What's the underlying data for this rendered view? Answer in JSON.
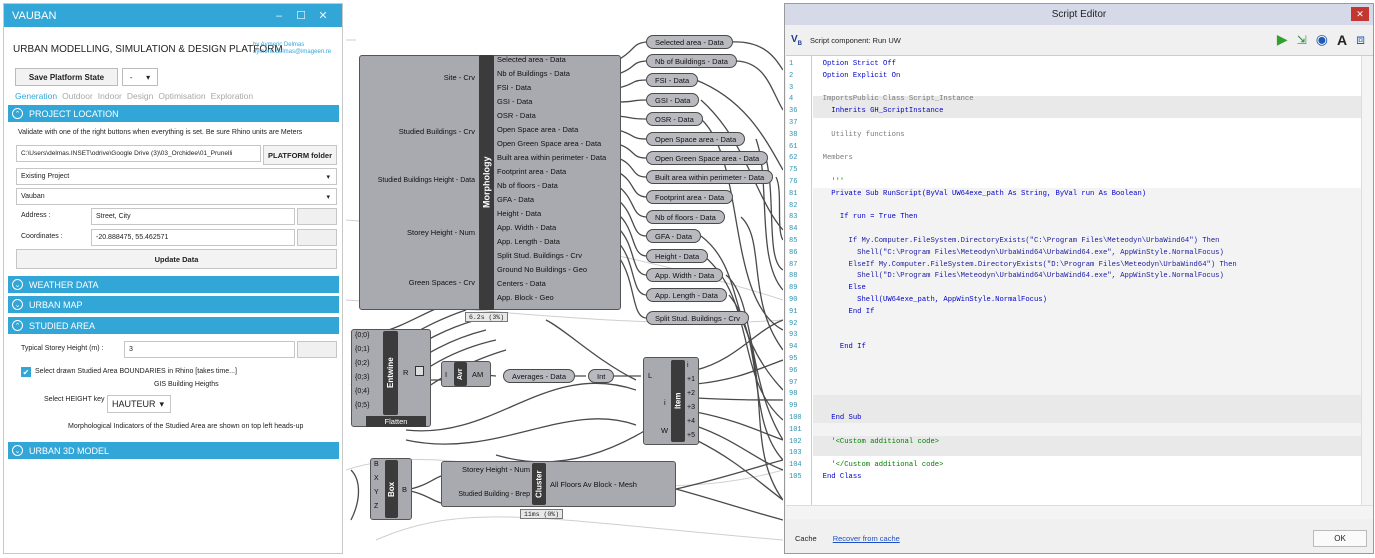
{
  "panel": {
    "title": "VAUBAN",
    "window_buttons": [
      "–",
      "☐",
      "✕"
    ],
    "platform_title": "URBAN MODELLING, SIMULATION & DESIGN PLATFORM",
    "author": "by Aymeric Delmas",
    "author_email": "aymeric.delmas@imageen.re",
    "save_button": "Save Platform State",
    "save_select": "-",
    "tabs": [
      "Generation",
      "Outdoor",
      "Indoor",
      "Design",
      "Optimisation",
      "Exploration"
    ],
    "project_location": {
      "header": "PROJECT LOCATION",
      "instruction": "Validate with one of the right buttons when everything is set. Be sure Rhino units are Meters",
      "path": "C:\\Users\\delmas.INSET\\odrive\\Google Drive (3)\\03_Orchidee\\01_Prunelli",
      "platform_folder_button": "PLATFORM folder",
      "project_type": "Existing Project",
      "project_name": "Vauban",
      "address_label": "Address :",
      "address_value": "Street, City",
      "coordinates_label": "Coordinates :",
      "coordinates_value": "-20.888475, 55.462571",
      "update_button": "Update Data"
    },
    "weather_header": "WEATHER DATA",
    "urban_map_header": "URBAN MAP",
    "studied_area": {
      "header": "STUDIED AREA",
      "storey_label": "Typical Storey Height (m) :",
      "storey_value": "3",
      "checkbox_label": "Select drawn Studied Area BOUNDARIES in Rhino [takes time...]",
      "gis_label": "GIS Building Heigths",
      "height_key_label": "Select HEIGHT key :",
      "height_key_value": "HAUTEUR",
      "note": "Morphological Indicators of the Studied Area are shown on top left heads-up"
    },
    "urban3d_header": "URBAN 3D MODEL"
  },
  "canvas": {
    "morph_inputs": [
      "Site - Crv",
      "Studied Buildings - Crv",
      "Studied Buildings Height - Data",
      "Storey Height - Num",
      "Green Spaces - Crv"
    ],
    "morph_label": "Morphology",
    "morph_outputs": [
      "Selected area - Data",
      "Nb of Buildings - Data",
      "FSI - Data",
      "GSI - Data",
      "OSR - Data",
      "Open Space area - Data",
      "Open Green Space area - Data",
      "Built area within perimeter - Data",
      "Footprint area - Data",
      "Nb of floors - Data",
      "GFA - Data",
      "Height - Data",
      "App. Width - Data",
      "App. Length - Data",
      "Split Stud. Buildings - Crv",
      "Ground No Buildings - Geo",
      "Centers - Data",
      "App. Block - Geo"
    ],
    "morph_time": "6.2s (3%)",
    "relays": [
      "Selected area - Data",
      "Nb of Buildings - Data",
      "FSI - Data",
      "GSI - Data",
      "OSR - Data",
      "Open Space area - Data",
      "Open Green Space area - Data",
      "Built area within perimeter - Data",
      "Footprint area - Data",
      "Nb of floors - Data",
      "GFA - Data",
      "Height - Data",
      "App. Width - Data",
      "App. Length - Data",
      "Split Stud. Buildings - Crv"
    ],
    "entwine_inputs": [
      "{0;0}",
      "{0;1}",
      "{0;2}",
      "{0;3}",
      "{0;4}",
      "{0;5}"
    ],
    "entwine_label": "Entwine",
    "entwine_output": "R",
    "flatten_label": "Flatten",
    "avr_in": "I",
    "avr_label": "Avr",
    "avr_out": "AM",
    "averages_label": "Averages - Data",
    "int_label": "Int",
    "item_label": "Item",
    "item_inputs": [
      "L",
      "i",
      "W"
    ],
    "item_outputs": [
      "i",
      "+1",
      "+2",
      "+3",
      "+4",
      "+5"
    ],
    "box_inputs": [
      "B",
      "X",
      "Y",
      "Z"
    ],
    "box_label": "Box",
    "box_output": "B",
    "cluster_inputs": [
      "Storey Height - Num",
      "Studied Building - Brep"
    ],
    "cluster_label": "Cluster",
    "cluster_output": "All Floors Av Block - Mesh",
    "cluster_time": "11ms (0%)"
  },
  "editor": {
    "title": "Script Editor",
    "close": "✕",
    "vb_icon": "V",
    "component": "Script component: Run UW",
    "line_numbers": [
      "1",
      "2",
      "3",
      "4",
      "36",
      "37",
      "38",
      "61",
      "62",
      "75",
      "76",
      "81",
      "82",
      "83",
      "84",
      "85",
      "86",
      "87",
      "88",
      "89",
      "90",
      "91",
      "92",
      "93",
      "94",
      "95",
      "96",
      "97",
      "98",
      "99",
      "100",
      "101",
      "102",
      "103",
      "104",
      "105"
    ],
    "code": [
      "  Option Strict Off",
      "  Option Explicit On",
      "",
      "  ImportsPublic Class Script_Instance",
      "    Inherits GH_ScriptInstance",
      "",
      "    Utility functions",
      "",
      "  Members",
      "",
      "    '''",
      "    Private Sub RunScript(ByVal UW64exe_path As String, ByVal run As Boolean)",
      "",
      "      If run = True Then",
      "",
      "        If My.Computer.FileSystem.DirectoryExists(\"C:\\Program Files\\Meteodyn\\UrbaWind64\") Then",
      "          Shell(\"C:\\Program Files\\Meteodyn\\UrbaWind64\\UrbaWind64.exe\", AppWinStyle.NormalFocus)",
      "        ElseIf My.Computer.FileSystem.DirectoryExists(\"D:\\Program Files\\Meteodyn\\UrbaWind64\") Then",
      "          Shell(\"D:\\Program Files\\Meteodyn\\UrbaWind64\\UrbaWind64.exe\", AppWinStyle.NormalFocus)",
      "        Else",
      "          Shell(UW64exe_path, AppWinStyle.NormalFocus)",
      "        End If",
      "",
      "",
      "      End If",
      "",
      "",
      "",
      "",
      "",
      "    End Sub",
      "",
      "    '<Custom additional code>",
      "",
      "    '</Custom additional code>",
      "  End Class"
    ],
    "cache_button": "Cache",
    "recover_link": "Recover from cache",
    "ok_button": "OK"
  }
}
